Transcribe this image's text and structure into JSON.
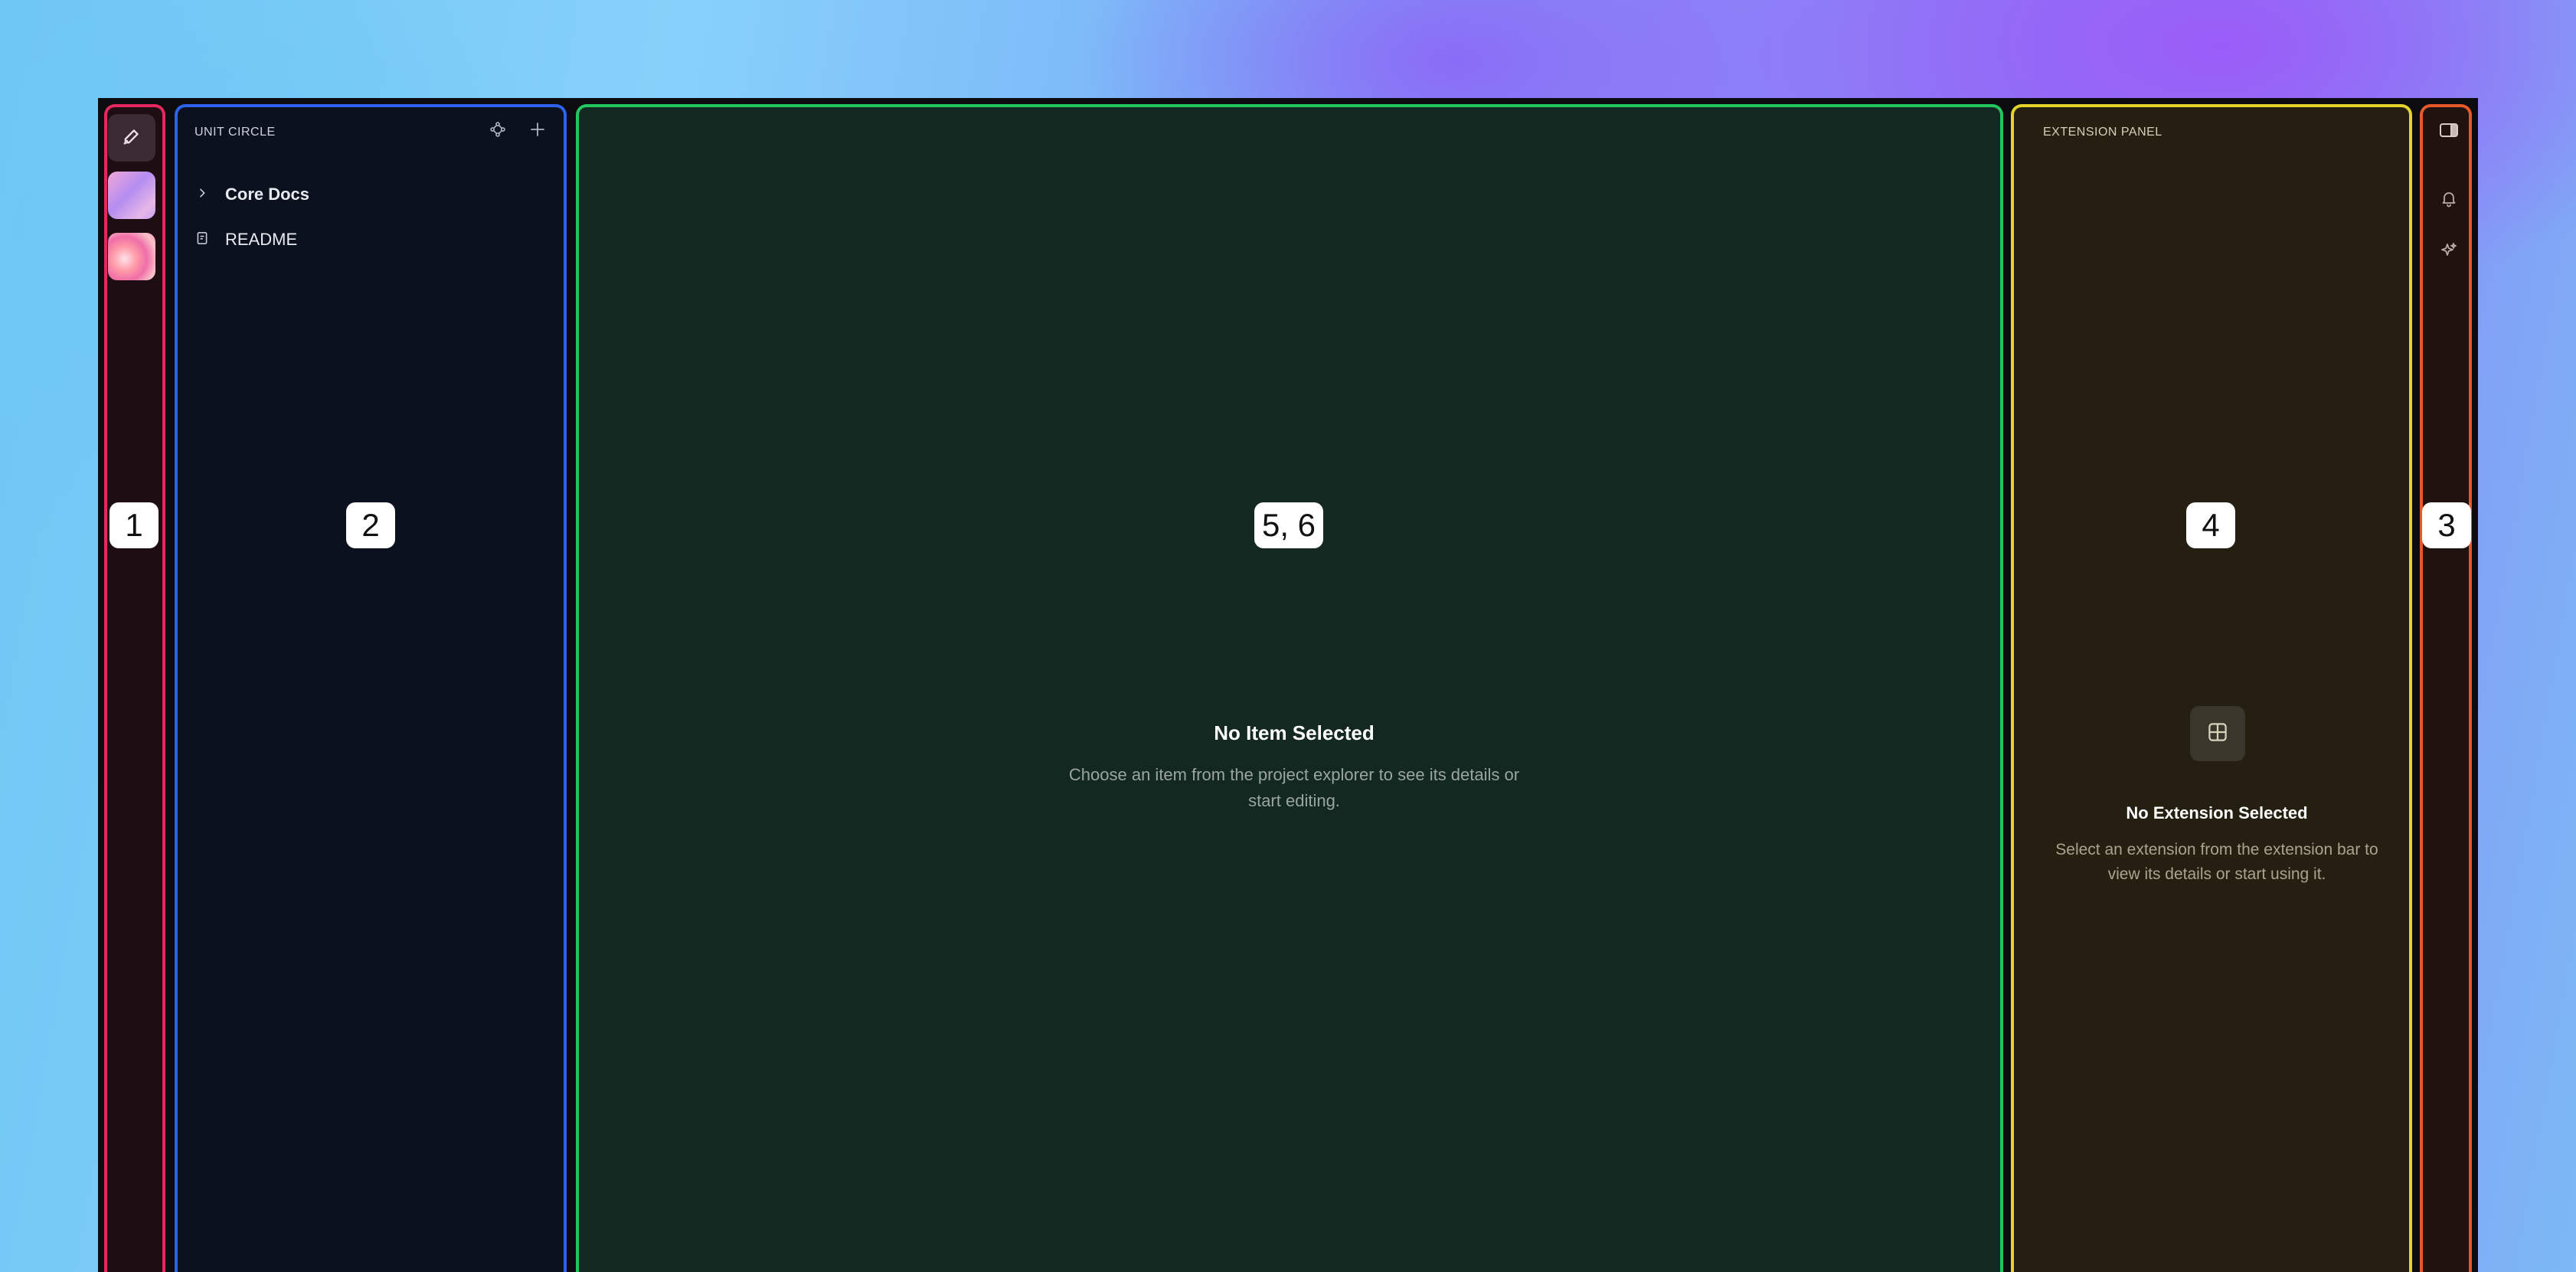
{
  "badges": {
    "activity_bar": "1",
    "explorer": "2",
    "main": "5, 6",
    "extension_panel": "4",
    "extension_bar": "3"
  },
  "activity_bar": {
    "items": [
      {
        "icon": "pen-icon"
      },
      {
        "icon": "workspace-avatar-gradient"
      },
      {
        "icon": "workspace-avatar-flower"
      }
    ]
  },
  "explorer": {
    "title": "UNIT CIRCLE",
    "actions": [
      {
        "icon": "graph-icon"
      },
      {
        "icon": "plus-icon"
      }
    ],
    "tree": [
      {
        "label": "Core Docs",
        "icon": "chevron-right-icon",
        "bold": true
      },
      {
        "label": "README",
        "icon": "document-icon",
        "bold": false
      }
    ]
  },
  "main": {
    "empty_title": "No Item Selected",
    "empty_desc": "Choose an item from the project explorer to see its details or start editing."
  },
  "extension_panel": {
    "title": "EXTENSION PANEL",
    "icon": "grid-icon",
    "empty_title": "No Extension Selected",
    "empty_desc": "Select an extension from the extension bar to view its details or start using it."
  },
  "extension_bar": {
    "items": [
      {
        "icon": "panel-toggle-icon"
      },
      {
        "icon": "bell-icon"
      },
      {
        "icon": "sparkles-icon"
      }
    ]
  },
  "colors": {
    "activity_border": "#e5265f",
    "explorer_border": "#2c62ec",
    "main_border": "#22c55e",
    "extension_panel_border": "#e5d22a",
    "extension_bar_border": "#e5582a"
  }
}
